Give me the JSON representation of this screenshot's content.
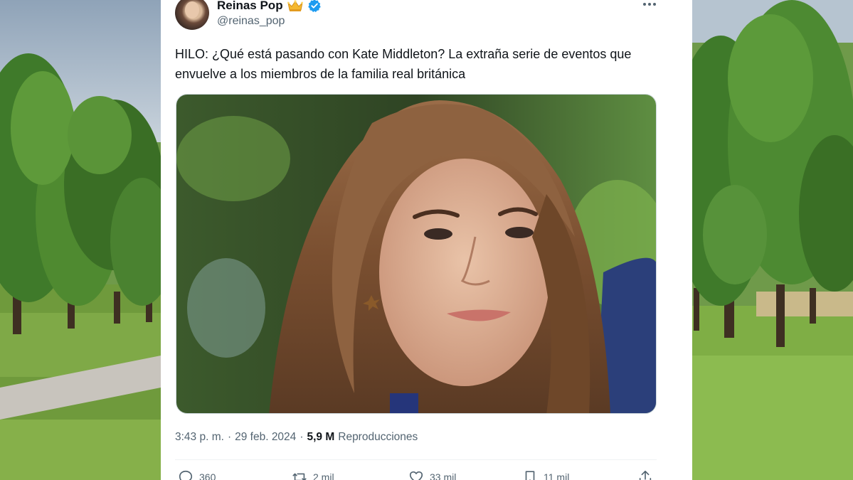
{
  "post": {
    "author": {
      "display_name": "Reinas Pop",
      "handle": "@reinas_pop",
      "badge_emoji": "crown-emoji",
      "verified_badge": "verified-icon"
    },
    "text": "HILO: ¿Qué está pasando con Kate Middleton? La extraña serie de eventos que envuelve a los miembros de la familia real británica",
    "media_description": "photo",
    "meta": {
      "time": "3:43 p. m.",
      "separator": "·",
      "date": "29 feb. 2024",
      "views_count": "5,9 M",
      "views_label": "Reproducciones"
    },
    "actions": {
      "replies": "360",
      "reposts": "2 mil",
      "likes": "33 mil",
      "bookmarks": "11 mil"
    }
  },
  "colors": {
    "text_primary": "#0f1419",
    "text_secondary": "#536471",
    "verified": "#1d9bf0",
    "divider": "#eff3f4"
  }
}
